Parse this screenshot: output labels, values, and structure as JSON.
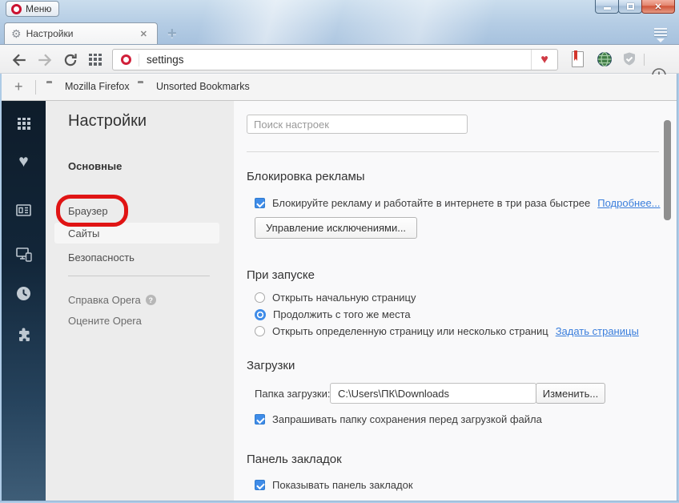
{
  "colors": {
    "accent_blue": "#3f8ce8",
    "link_blue": "#3a7edc",
    "annotation_red": "#e01414"
  },
  "titlebar": {
    "menu_label": "Меню"
  },
  "tabbar": {
    "active_tab_title": "Настройки",
    "gear_glyph": "⚙",
    "close_glyph": "✕",
    "new_tab_glyph": "+"
  },
  "toolbar": {
    "address_value": "settings",
    "heart_glyph": "♥"
  },
  "bookmarks_bar": {
    "add_glyph": "+",
    "items": [
      {
        "label": "Mozilla Firefox"
      },
      {
        "label": "Unsorted Bookmarks"
      }
    ]
  },
  "sidebar_icons": {
    "heart_glyph": "♥"
  },
  "settings_nav": {
    "title": "Настройки",
    "group_label": "Основные",
    "items": [
      {
        "label": "Браузер"
      },
      {
        "label": "Сайты"
      },
      {
        "label": "Безопасность"
      }
    ],
    "help_link": "Справка Opera",
    "help_badge": "?",
    "rate_link": "Оцените Opera"
  },
  "main": {
    "search_placeholder": "Поиск настроек",
    "adblock": {
      "heading": "Блокировка рекламы",
      "checkbox_label": "Блокируйте рекламу и работайте в интернете в три раза быстрее",
      "more_link": "Подробнее...",
      "exceptions_button": "Управление исключениями..."
    },
    "startup": {
      "heading": "При запуске",
      "option1": "Открыть начальную страницу",
      "option2": "Продолжить с того же места",
      "option3": "Открыть определенную страницу или несколько страниц",
      "set_pages_link": "Задать страницы"
    },
    "downloads": {
      "heading": "Загрузки",
      "folder_label": "Папка загрузки:",
      "folder_path": "C:\\Users\\ПК\\Downloads",
      "change_button": "Изменить...",
      "ask_checkbox": "Запрашивать папку сохранения перед загрузкой файла"
    },
    "bookmarks": {
      "heading": "Панель закладок",
      "show_checkbox": "Показывать панель закладок"
    }
  }
}
